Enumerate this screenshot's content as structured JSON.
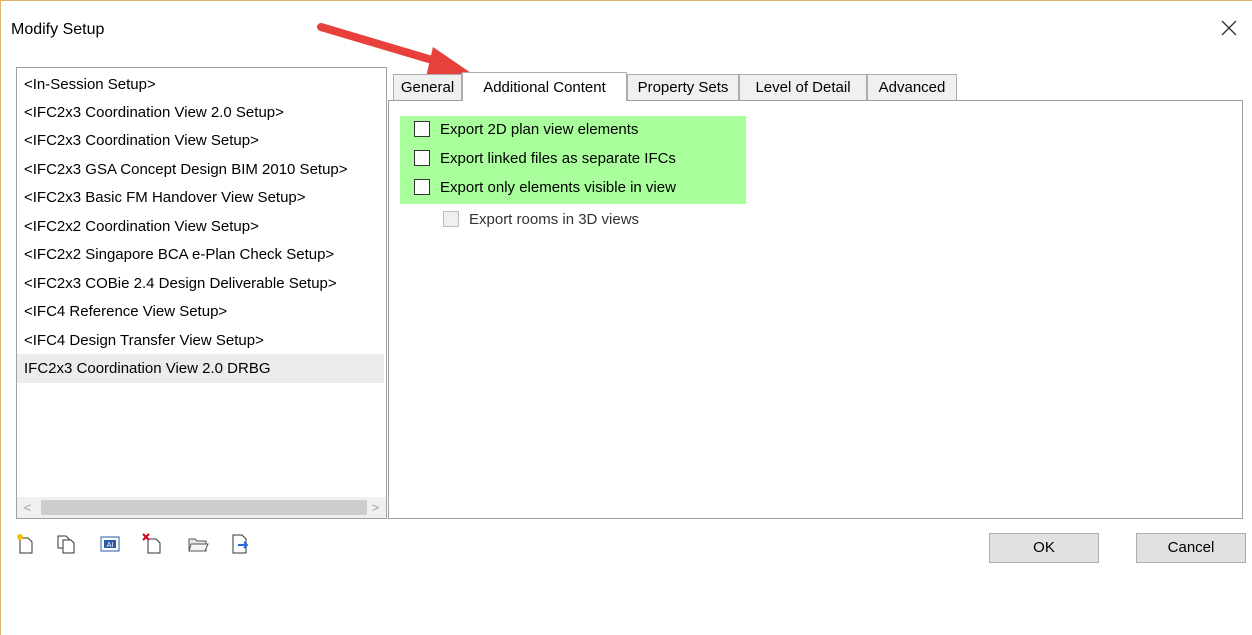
{
  "window": {
    "title": "Modify Setup"
  },
  "setups": [
    "<In-Session Setup>",
    "<IFC2x3 Coordination View 2.0 Setup>",
    "<IFC2x3 Coordination View Setup>",
    "<IFC2x3 GSA Concept Design BIM 2010 Setup>",
    "<IFC2x3 Basic FM Handover View Setup>",
    "<IFC2x2 Coordination View Setup>",
    "<IFC2x2 Singapore BCA e-Plan Check Setup>",
    "<IFC2x3 COBie 2.4 Design Deliverable Setup>",
    "<IFC4 Reference View Setup>",
    "<IFC4 Design Transfer View Setup>",
    "IFC2x3 Coordination View 2.0 DRBG"
  ],
  "selected_setup": "IFC2x3 Coordination View 2.0 DRBG",
  "tabs": [
    "General",
    "Additional Content",
    "Property Sets",
    "Level of Detail",
    "Advanced"
  ],
  "active_tab": "Additional Content",
  "options": [
    {
      "label": "Export 2D plan view elements",
      "checked": false,
      "enabled": true
    },
    {
      "label": "Export linked files as separate IFCs",
      "checked": false,
      "enabled": true
    },
    {
      "label": "Export only elements visible in view",
      "checked": false,
      "enabled": true
    },
    {
      "label": "Export rooms in 3D views",
      "checked": false,
      "enabled": false
    }
  ],
  "buttons": {
    "ok": "OK",
    "cancel": "Cancel"
  },
  "toolbar_icons": [
    "new-setup-icon",
    "duplicate-setup-icon",
    "rename-setup-icon",
    "delete-setup-icon",
    "import-setup-icon",
    "export-setup-icon"
  ],
  "colors": {
    "highlight": "#a8ff9c",
    "annotation_arrow": "#e8403a",
    "window_border": "#e0b36a"
  }
}
